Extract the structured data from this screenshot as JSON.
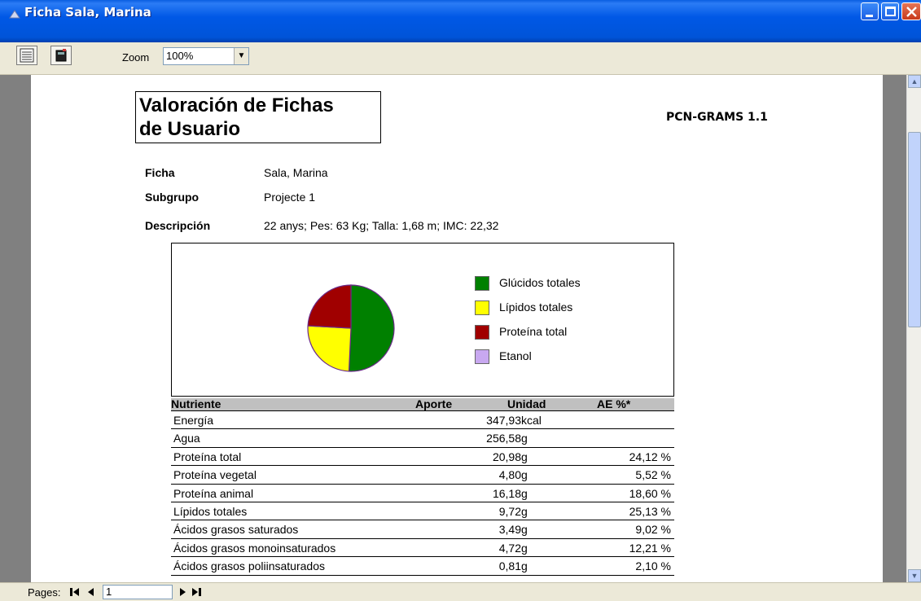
{
  "window": {
    "title": "Ficha Sala, Marina"
  },
  "toolbar": {
    "zoom_label": "Zoom",
    "zoom_value": "100%",
    "print_icon": "printer-icon",
    "export_icon": "export-icon"
  },
  "statusbar": {
    "pages_label": "Pages:",
    "first": "⏮",
    "prev": "◀",
    "page_number": "1",
    "next": "▶",
    "last": "⏭"
  },
  "report": {
    "title_line1": "Valoración de Fichas",
    "title_line2": "de Usuario",
    "brand": "PCN-GRAMS 1.1",
    "fields": [
      {
        "label": "Ficha",
        "value": "Sala, Marina"
      },
      {
        "label": "Subgrupo",
        "value": "Projecte 1"
      },
      {
        "label": "Descripción",
        "value": "22 anys; Pes: 63 Kg; Talla: 1,68 m; IMC: 22,32"
      }
    ]
  },
  "chart_data": {
    "type": "pie",
    "labels": [
      "Glúcidos totales",
      "Lípidos totales",
      "Proteína total",
      "Etanol"
    ],
    "values": [
      50.75,
      25.13,
      24.12,
      0
    ],
    "colors": [
      "#008000",
      "#ffff00",
      "#a00000",
      "#c8a8f0"
    ],
    "title": "",
    "legend": "right"
  },
  "table": {
    "headers": {
      "name": "Nutriente",
      "value": "Aporte",
      "unit": "Unidad",
      "ae": "AE %*"
    },
    "rows": [
      {
        "name": "Energía",
        "value": "347,93",
        "unit": "kcal",
        "ae": ""
      },
      {
        "name": "Agua",
        "value": "256,58",
        "unit": "g",
        "ae": ""
      },
      {
        "name": "Proteína total",
        "value": "20,98",
        "unit": "g",
        "ae": "24,12 %"
      },
      {
        "name": "Proteína vegetal",
        "value": "4,80",
        "unit": "g",
        "ae": "5,52 %"
      },
      {
        "name": "Proteína animal",
        "value": "16,18",
        "unit": "g",
        "ae": "18,60 %"
      },
      {
        "name": "Lípidos totales",
        "value": "9,72",
        "unit": "g",
        "ae": "25,13 %"
      },
      {
        "name": "Ácidos grasos saturados",
        "value": "3,49",
        "unit": "g",
        "ae": "9,02 %"
      },
      {
        "name": "Ácidos grasos monoinsaturados",
        "value": "4,72",
        "unit": "g",
        "ae": "12,21 %"
      },
      {
        "name": "Ácidos grasos poliinsaturados",
        "value": "0,81",
        "unit": "g",
        "ae": "2,10 %"
      }
    ]
  }
}
